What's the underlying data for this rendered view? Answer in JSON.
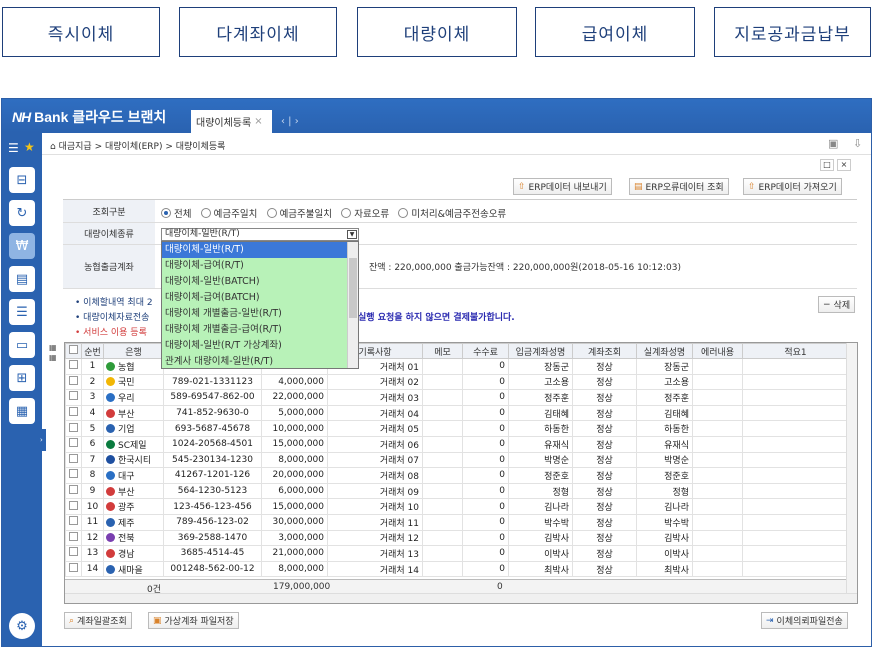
{
  "top_tabs": [
    "즉시이체",
    "다계좌이체",
    "대량이체",
    "급여이체",
    "지로공과금납부"
  ],
  "app": {
    "brand_nh": "NH",
    "brand_rest": " Bank 클라우드 브랜치",
    "tab_label": "대량이체등록",
    "tab_close": "×",
    "tab_nav": "‹ | ›"
  },
  "breadcrumb": "대금지급 > 대량이체(ERP) > 대량이체등록",
  "window_controls": [
    "□",
    "×"
  ],
  "toolbar": {
    "export": "ERP데이터 내보내기",
    "error_lookup": "ERP오류데이터 조회",
    "import": "ERP데이터 가져오기"
  },
  "form": {
    "query_label": "조회구분",
    "query_options": [
      "전체",
      "예금주일치",
      "예금주불일치",
      "자료오류",
      "미처리&예금주전송오류"
    ],
    "type_label": "대량이체종류",
    "type_value": "대량이체-일반(R/T)",
    "account_label": "농협출금계좌",
    "balance_text": "잔액 : 220,000,000  출금가능잔액 : 220,000,000원(2018-05-16 10:12:03)"
  },
  "dropdown_options": [
    "대량이체-일반(R/T)",
    "대량이체-급여(R/T)",
    "대량이체-일반(BATCH)",
    "대량이체-급여(BATCH)",
    "대량이체 개별출금-일반(R/T)",
    "대량이체 개별출금-급여(R/T)",
    "대량이체-일반(R/T 가상계좌)",
    "관계사 대량이체-일반(R/T)"
  ],
  "notes": [
    "이체할내역 최대 2",
    "대량이체자료전송",
    "서비스 이용 등록"
  ],
  "notes_tail": "실행 요청을 하지 않으면 결제불가합니다.",
  "delete_button": "삭제",
  "table": {
    "headers": [
      "순번",
      "은행",
      "",
      "",
      "",
      "기록사항",
      "메모",
      "수수료",
      "입금계좌성명",
      "계좌조회",
      "실계좌성명",
      "에러내용",
      "적요1"
    ],
    "rows": [
      [
        "1",
        "농협",
        "",
        "",
        "거래처 01",
        "",
        "0",
        "장동군",
        "정상",
        "장동군"
      ],
      [
        "2",
        "국민",
        "789-021-1331123",
        "4,000,000",
        "거래처 02",
        "",
        "0",
        "고소용",
        "정상",
        "고소용"
      ],
      [
        "3",
        "우리",
        "589-69547-862-00",
        "22,000,000",
        "거래처 03",
        "",
        "0",
        "정주훈",
        "정상",
        "정주훈"
      ],
      [
        "4",
        "부산",
        "741-852-9630-0",
        "5,000,000",
        "거래처 04",
        "",
        "0",
        "김태혜",
        "정상",
        "김태혜"
      ],
      [
        "5",
        "기업",
        "693-5687-45678",
        "10,000,000",
        "거래처 05",
        "",
        "0",
        "하동한",
        "정상",
        "하동한"
      ],
      [
        "6",
        "SC제일",
        "1024-20568-4501",
        "15,000,000",
        "거래처 06",
        "",
        "0",
        "유재식",
        "정상",
        "유재식"
      ],
      [
        "7",
        "한국시티",
        "545-230134-1230",
        "8,000,000",
        "거래처 07",
        "",
        "0",
        "박명순",
        "정상",
        "박명순"
      ],
      [
        "8",
        "대구",
        "41267-1201-126",
        "20,000,000",
        "거래처 08",
        "",
        "0",
        "정준호",
        "정상",
        "정준호"
      ],
      [
        "9",
        "부산",
        "564-1230-5123",
        "6,000,000",
        "거래처 09",
        "",
        "0",
        "정형",
        "정상",
        "정형"
      ],
      [
        "10",
        "광주",
        "123-456-123-456",
        "15,000,000",
        "거래처 10",
        "",
        "0",
        "김나라",
        "정상",
        "김나라"
      ],
      [
        "11",
        "제주",
        "789-456-123-02",
        "30,000,000",
        "거래처 11",
        "",
        "0",
        "박수박",
        "정상",
        "박수박"
      ],
      [
        "12",
        "전북",
        "369-2588-1470",
        "3,000,000",
        "거래처 12",
        "",
        "0",
        "김박사",
        "정상",
        "김박사"
      ],
      [
        "13",
        "경남",
        "3685-4514-45",
        "21,000,000",
        "거래처 13",
        "",
        "0",
        "이박사",
        "정상",
        "이박사"
      ],
      [
        "14",
        "새마을",
        "001248-562-00-12",
        "8,000,000",
        "거래처 14",
        "",
        "0",
        "최박사",
        "정상",
        "최박사"
      ]
    ],
    "bank_colors": [
      "#2e9b3a",
      "#f2b705",
      "#2a6fc4",
      "#d23c3c",
      "#2a62b0",
      "#0a7b3f",
      "#1e4fa0",
      "#2a6fc4",
      "#d23c3c",
      "#d23c3c",
      "#2a62b0",
      "#7a3fb0",
      "#d23c3c",
      "#2a62b0"
    ],
    "sum_count": "0건",
    "sum_amount": "179,000,000",
    "sum_fee": "0"
  },
  "bottom": {
    "account_lookup": "계좌일괄조회",
    "save_virtual": "가상계좌 파일저장",
    "send": "이체의뢰파일전송"
  }
}
